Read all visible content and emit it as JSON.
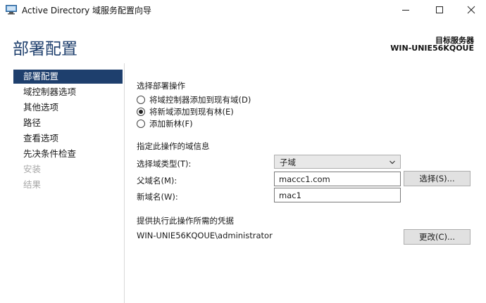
{
  "window": {
    "title": "Active Directory 域服务配置向导"
  },
  "header": {
    "page_title": "部署配置",
    "target_server_label": "目标服务器",
    "target_server_name": "WIN-UNIE56KQOUE"
  },
  "nav": {
    "items": [
      {
        "label": "部署配置",
        "state": "active"
      },
      {
        "label": "域控制器选项",
        "state": "normal"
      },
      {
        "label": "其他选项",
        "state": "normal"
      },
      {
        "label": "路径",
        "state": "normal"
      },
      {
        "label": "查看选项",
        "state": "normal"
      },
      {
        "label": "先决条件检查",
        "state": "normal"
      },
      {
        "label": "安装",
        "state": "disabled"
      },
      {
        "label": "结果",
        "state": "disabled"
      }
    ]
  },
  "deployment": {
    "section_label": "选择部署操作",
    "options": [
      {
        "label": "将域控制器添加到现有域(D)",
        "checked": false
      },
      {
        "label": "将新域添加到现有林(E)",
        "checked": true
      },
      {
        "label": "添加新林(F)",
        "checked": false
      }
    ]
  },
  "domain_info": {
    "section_label": "指定此操作的域信息",
    "domain_type_label": "选择域类型(T):",
    "domain_type_value": "子域",
    "parent_domain_label": "父域名(M):",
    "parent_domain_value": "maccc1.com",
    "select_button": "选择(S)...",
    "new_domain_label": "新域名(W):",
    "new_domain_value": "mac1"
  },
  "credentials": {
    "section_label": "提供执行此操作所需的凭据",
    "account": "WIN-UNIE56KQOUE\\administrator",
    "change_button": "更改(C)..."
  },
  "icons": {
    "app": "ad-wizard-icon",
    "minimize": "minimize-icon",
    "maximize": "maximize-icon",
    "close": "close-icon",
    "dropdown": "chevron-down-icon"
  },
  "colors": {
    "accent": "#1e3f6d",
    "disabled_text": "#a8a8a8"
  }
}
